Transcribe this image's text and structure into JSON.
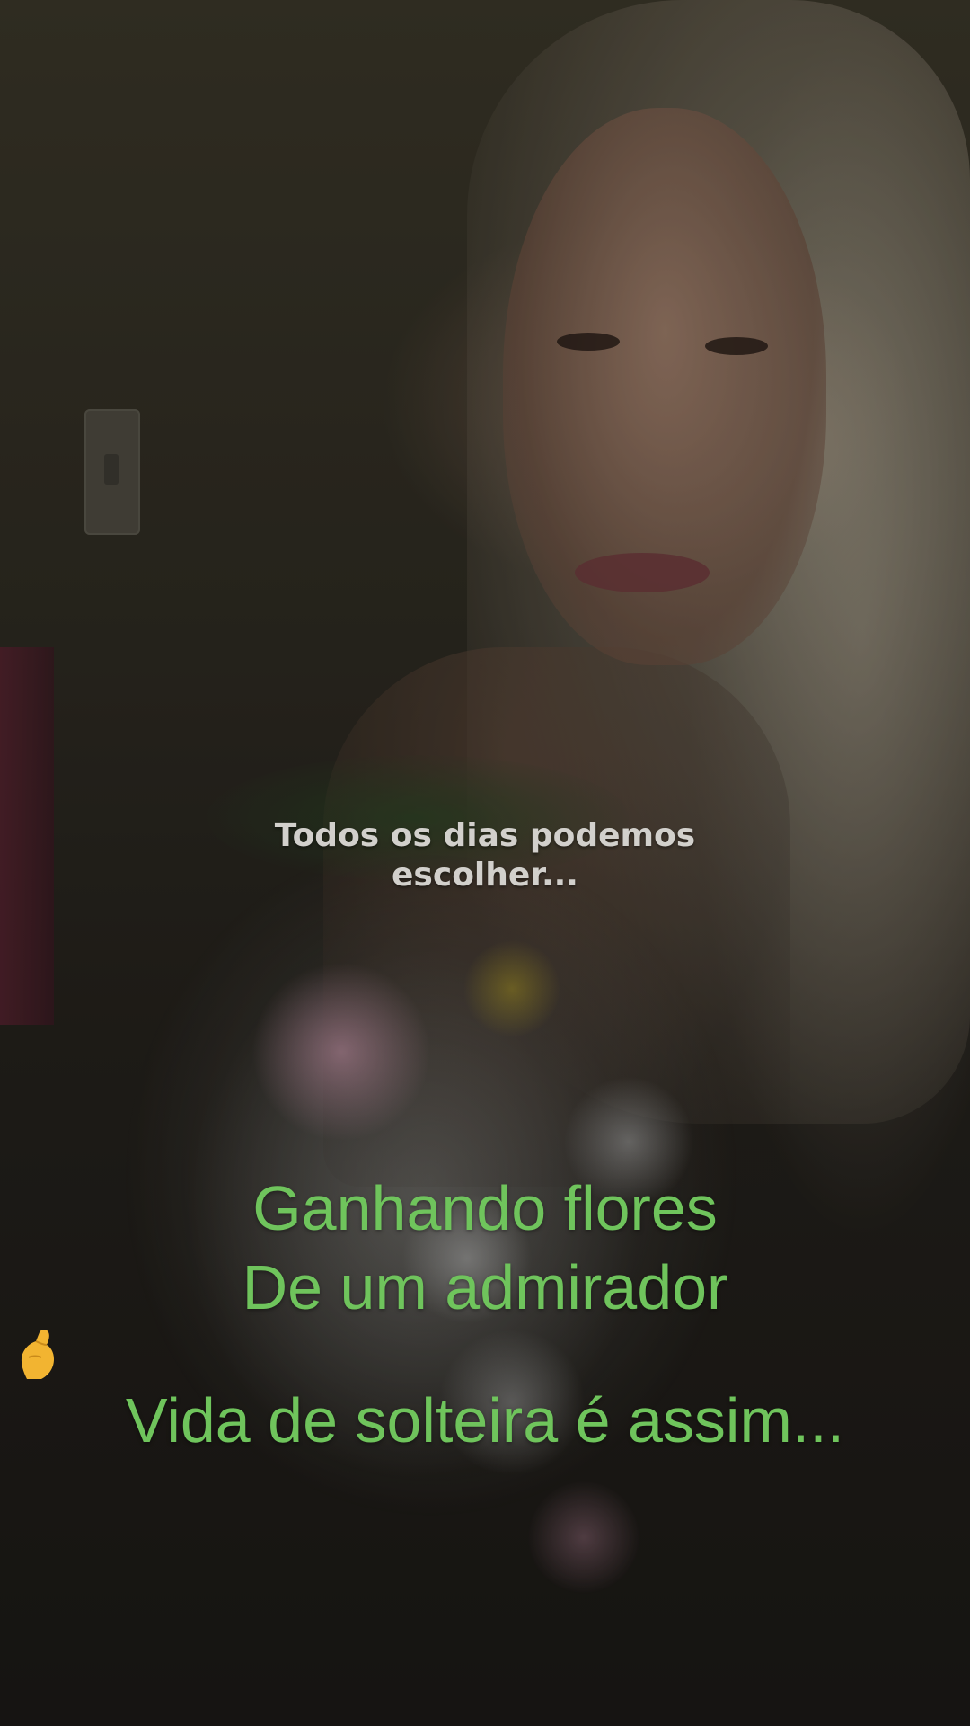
{
  "overlay": {
    "top_caption": {
      "line1": "Todos os dias podemos",
      "line2": "escolher..."
    },
    "main_caption": {
      "line1": "Ganhando flores",
      "line2": "De um admirador",
      "line2_icon": "pinched-fingers-emoji",
      "line3": "Vida de solteira é assim..."
    }
  },
  "colors": {
    "main_caption": "#6fc45c",
    "top_caption": "#d2d0cc"
  }
}
